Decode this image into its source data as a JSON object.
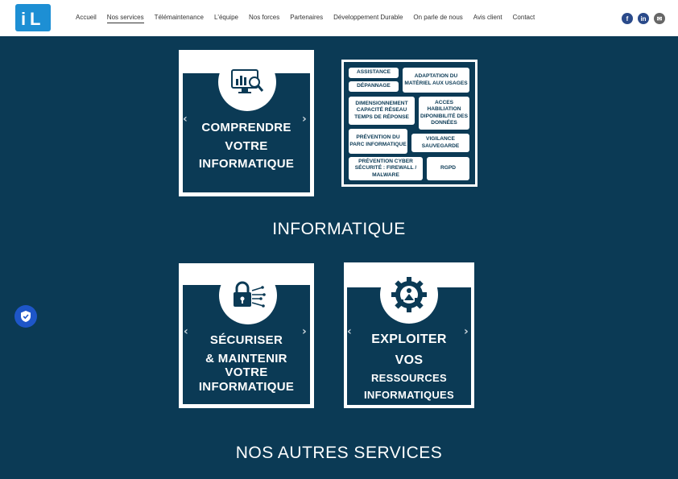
{
  "nav": {
    "items": [
      "Accueil",
      "Nos services",
      "Télémaintenance",
      "L'équipe",
      "Nos forces",
      "Partenaires",
      "Développement Durable",
      "On parle de nous",
      "Avis client",
      "Contact"
    ],
    "active_index": 1
  },
  "social": {
    "facebook": "f",
    "linkedin": "in",
    "email": "✉"
  },
  "logo": {
    "i": "i",
    "l": "L"
  },
  "cards": {
    "comprendre": {
      "line1": "COMPRENDRE",
      "line2": "VOTRE",
      "line3": "INFORMATIQUE"
    },
    "securiser": {
      "line1": "SÉCURISER",
      "line2": "& MAINTENIR",
      "line3": "VOTRE",
      "line4": "INFORMATIQUE"
    },
    "exploiter": {
      "line1": "EXPLOITER",
      "line2": "VOS",
      "line3": "RESSOURCES",
      "line4": "INFORMATIQUES"
    }
  },
  "tiles": {
    "assistance": "ASSISTANCE",
    "adaptation": "ADAPTATION DU MATÉRIEL AUX USAGES",
    "depannage": "DÉPANNAGE",
    "dimensionnement": "DIMENSIONNEMENT CAPACITÉ RÉSEAU TEMPS DE RÉPONSE",
    "acces": "ACCES HABILIATION DIPONIBILITÉ DES DONNÉES",
    "prevention_parc": "PRÉVENTION DU PARC INFORMATIQUE",
    "vigilance": "VIGILANCE SAUVEGARDE",
    "prevention_cyber": "PRÉVENTION CYBER SÉCURITÉ : FIREWALL / MALWARE",
    "rgpd": "RGPD"
  },
  "sections": {
    "informatique": "INFORMATIQUE",
    "autres": "NOS AUTRES SERVICES"
  },
  "arrows": {
    "prev": "‹",
    "next": "›"
  },
  "colors": {
    "background": "#0b3a55",
    "brand_blue": "#1d8fd4",
    "shield_button": "#1e56c8"
  },
  "icons": [
    "monitor-chart-icon",
    "padlock-circuit-icon",
    "gear-worker-icon",
    "shield-check-icon",
    "facebook-icon",
    "linkedin-icon",
    "email-icon"
  ]
}
